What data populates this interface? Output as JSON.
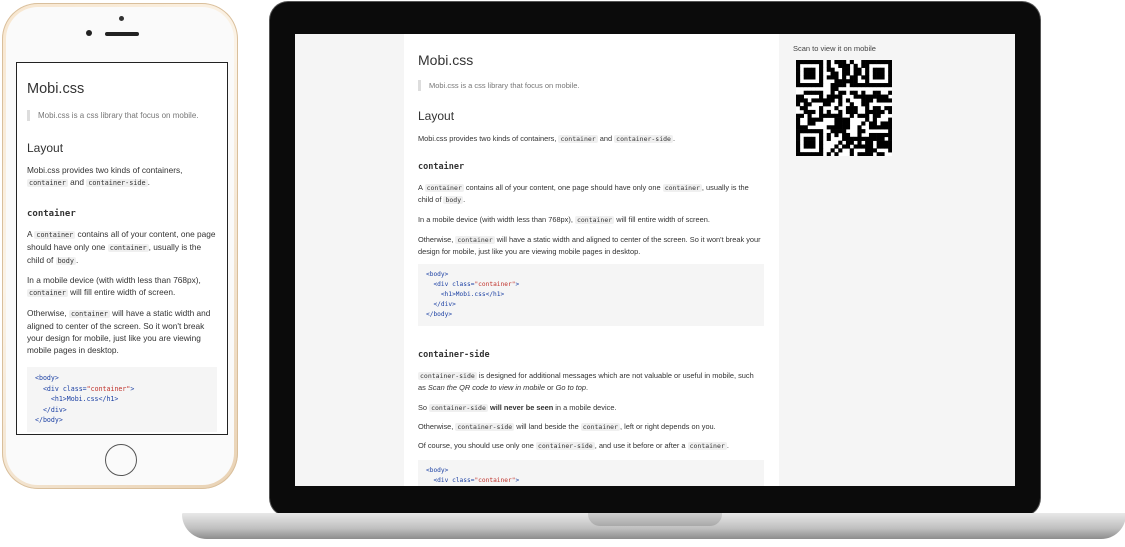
{
  "doc": {
    "title": "Mobi.css",
    "quote": "Mobi.css is a css library that focus on mobile.",
    "layout_heading": "Layout",
    "layout_intro": [
      "Mobi.css provides two kinds of containers, ",
      "container",
      " and ",
      "container-side",
      "."
    ],
    "container_heading": "container",
    "container_p1": [
      "A ",
      "container",
      " contains all of your content, one page should have only one ",
      "container",
      ", usually is the child of ",
      "body",
      "."
    ],
    "container_p2": [
      "In a mobile device (with width less than 768px), ",
      "container",
      " will fill entire width of screen."
    ],
    "container_p3": [
      "Otherwise, ",
      "container",
      " will have a static width and aligned to center of the screen. So it won't break your design for mobile, just like you are viewing mobile pages in desktop."
    ],
    "code_body_open": "<body>",
    "code_div_open": "<div",
    "code_class_attr": "class=",
    "code_class_value": "\"container\"",
    "code_h1": "<h1>Mobi.css</h1>",
    "code_div_close": "</div>",
    "code_body_close": "</body>",
    "side_heading": "container-side",
    "side_p1": [
      "container-side",
      " is designed for additional messages which are not valuable or useful in mobile, such as ",
      "Scan the QR code to view in mobile",
      " or ",
      "Go to top",
      "."
    ],
    "side_p2": [
      "So ",
      "container-side",
      " ",
      "will never be seen",
      " in a mobile device."
    ],
    "side_p3": [
      "Otherwise, ",
      "container-side",
      " will land beside the ",
      "container",
      ", left or right depends on you."
    ],
    "side_p4": [
      "Of course, you should use only one ",
      "container-side",
      ", and use it before or after a ",
      "container",
      "."
    ],
    "scan_text": "Scan to view it on mobile"
  }
}
